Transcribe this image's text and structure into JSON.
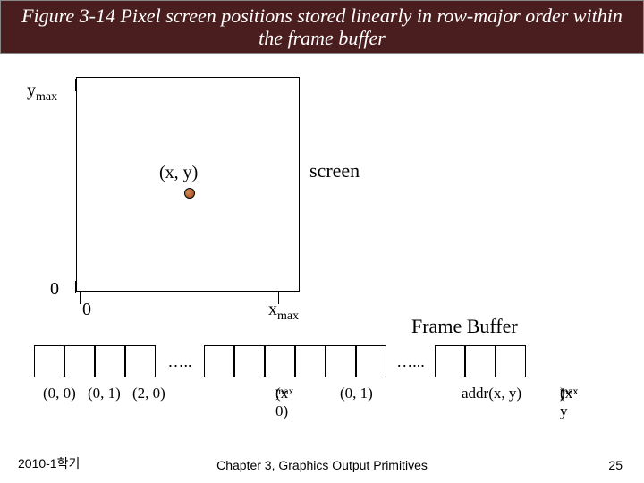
{
  "title": "Figure 3-14 Pixel screen positions stored linearly in row-major order within the frame buffer",
  "axes": {
    "ymax_base": "y",
    "ymax_sub": "max",
    "zero": "0",
    "xmax_base": "x",
    "xmax_sub": "max"
  },
  "labels": {
    "pixel_xy": "(x, y)",
    "screen": "screen",
    "frame_buffer": "Frame Buffer"
  },
  "ellipses": {
    "left": "…..",
    "right": "…..."
  },
  "addresses": {
    "a00": "(0, 0)",
    "a01": "(0, 1)",
    "a20": "(2, 0)",
    "am0_pre": "(x",
    "am0_sub": "max",
    "am0_post": ", 0)",
    "a01b": "(0, 1)",
    "addr_xy": "addr(x, y)",
    "amm_pre": "(x",
    "amm_subx": "max",
    "amm_mid": ", y",
    "amm_suby": "max",
    "amm_post": ")"
  },
  "footer": {
    "left": "2010-1학기",
    "center": "Chapter 3, Graphics Output Primitives",
    "right": "25"
  }
}
